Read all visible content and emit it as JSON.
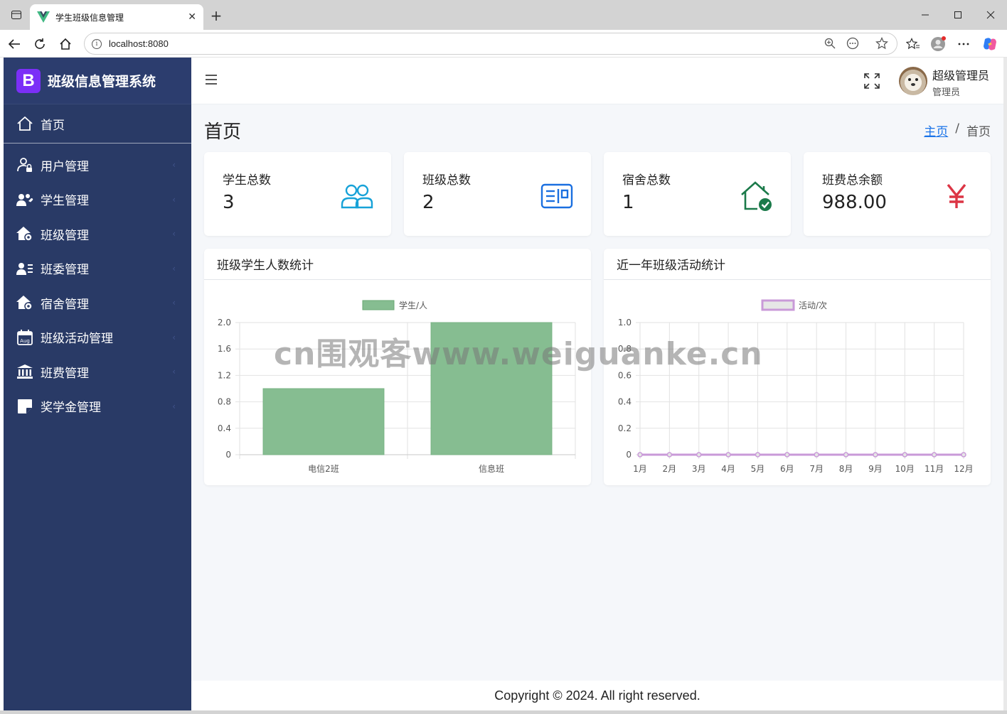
{
  "browser": {
    "tab_title": "学生班级信息管理",
    "url": "localhost:8080",
    "new_tab": "+",
    "tab_close": "✕"
  },
  "sidebar": {
    "brand_logo": "B",
    "brand_title": "班级信息管理系统",
    "home": {
      "label": "首页",
      "icon": "home-icon"
    },
    "items": [
      {
        "label": "用户管理",
        "icon": "user-lock-icon"
      },
      {
        "label": "学生管理",
        "icon": "users-heart-icon"
      },
      {
        "label": "班级管理",
        "icon": "house-gear-icon"
      },
      {
        "label": "班委管理",
        "icon": "user-list-icon"
      },
      {
        "label": "宿舍管理",
        "icon": "house-gear-icon"
      },
      {
        "label": "班级活动管理",
        "icon": "calendar-aug-icon"
      },
      {
        "label": "班费管理",
        "icon": "bank-icon"
      },
      {
        "label": "奖学金管理",
        "icon": "sticky-note-icon"
      }
    ],
    "chevron": "‹"
  },
  "header": {
    "user_name": "超级管理员",
    "user_role": "管理员"
  },
  "page": {
    "title": "首页",
    "breadcrumb_home": "主页",
    "breadcrumb_sep": "/",
    "breadcrumb_current": "首页"
  },
  "stats": [
    {
      "label": "学生总数",
      "value": "3",
      "icon": "people-icon",
      "color": "#17a2d8"
    },
    {
      "label": "班级总数",
      "value": "2",
      "icon": "id-card-icon",
      "color": "#1a6fe0"
    },
    {
      "label": "宿舍总数",
      "value": "1",
      "icon": "house-check-icon",
      "color": "#1b7a4a"
    },
    {
      "label": "班费总余额",
      "value": "988.00",
      "icon": "yen-icon",
      "color": "#dc3545"
    }
  ],
  "charts": {
    "students": {
      "title": "班级学生人数统计"
    },
    "activities": {
      "title": "近一年班级活动统计"
    }
  },
  "chart_data": [
    {
      "type": "bar",
      "legend": "学生/人",
      "categories": [
        "电信2班",
        "信息班"
      ],
      "series": [
        {
          "name": "学生/人",
          "values": [
            1,
            2
          ]
        }
      ],
      "yticks": [
        "0",
        "0.4",
        "0.8",
        "1.2",
        "1.6",
        "2.0"
      ],
      "ylim": [
        0,
        2
      ],
      "color": "#86bd91"
    },
    {
      "type": "line",
      "legend": "活动/次",
      "categories": [
        "1月",
        "2月",
        "3月",
        "4月",
        "5月",
        "6月",
        "7月",
        "8月",
        "9月",
        "10月",
        "11月",
        "12月"
      ],
      "series": [
        {
          "name": "活动/次",
          "values": [
            0,
            0,
            0,
            0,
            0,
            0,
            0,
            0,
            0,
            0,
            0,
            0
          ]
        }
      ],
      "yticks": [
        "0",
        "0.2",
        "0.4",
        "0.6",
        "0.8",
        "1.0"
      ],
      "ylim": [
        0,
        1
      ],
      "color": "#c99ad8"
    }
  ],
  "footer": {
    "text": "Copyright © 2024. All right reserved."
  },
  "watermark": "cn围观客www.weiguanke.cn"
}
